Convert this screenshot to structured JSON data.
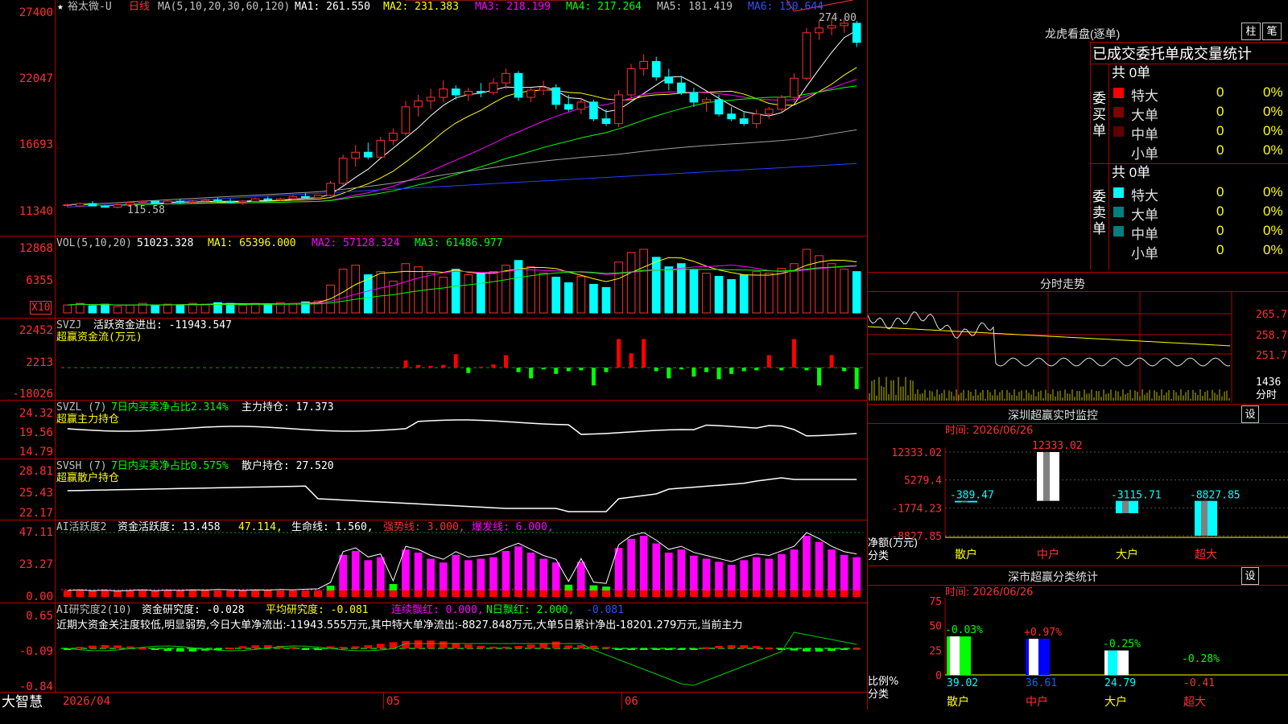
{
  "title_bar": {
    "star": "★",
    "stock_name": "裕太微-U",
    "period": "日线",
    "ma_label": "MA(5,10,20,30,60,120)",
    "ma1": "MA1: 261.550",
    "ma2": "MA2: 231.383",
    "ma3": "MA3: 218.199",
    "ma4": "MA4: 217.264",
    "ma5": "MA5: 181.419",
    "ma6": "MA6: 150.644"
  },
  "price_panel": {
    "y_ticks": [
      "27400",
      "22047",
      "16693",
      "11340"
    ],
    "high_label": "274.00",
    "low_label": "115.58"
  },
  "vol_panel": {
    "label": "VOL(5,10,20)",
    "value": "51023.328",
    "ma1": "MA1: 65396.000",
    "ma2": "MA2: 57128.324",
    "ma3": "MA3: 61486.977",
    "y_ticks": [
      "12868",
      "6355"
    ],
    "unit": "X10"
  },
  "svzj_panel": {
    "label": "SVZJ",
    "text": "活跃资金进出: -11943.547",
    "sub": "超赢资金流(万元)",
    "y_ticks": [
      "22452",
      "2213",
      "-18026"
    ]
  },
  "svzl_panel": {
    "label": "SVZL (7)",
    "text1": "7日内买卖净占比2.314%",
    "text2": "主力持仓: 17.373",
    "sub": "超赢主力持仓",
    "y_ticks": [
      "24.32",
      "19.56",
      "14.79"
    ]
  },
  "svsh_panel": {
    "label": "SVSH (7)",
    "text1": "7日内买卖净占比0.575%",
    "text2": "散户持仓: 27.520",
    "sub": "超赢散户持仓",
    "y_ticks": [
      "28.81",
      "25.43",
      "22.17"
    ]
  },
  "ai_panel": {
    "label": "AI活跃度2",
    "t1": "资金活跃度: 13.458",
    "t2": "47.114,",
    "t3": "生命线: 1.560,",
    "t4": "强势线: 3.000,",
    "t5": "爆发线: 6.000,",
    "y_ticks": [
      "47.11",
      "23.27",
      "0.00"
    ]
  },
  "research_panel": {
    "label": "AI研究度2(10)",
    "t1": "资金研究度: -0.028",
    "t2": "平均研究度: -0.081",
    "t3": "连续飘红: 0.000,",
    "t4": "N日飘红: 2.000,",
    "t5": "-0.081",
    "comment": "近期大资金关注度较低,明显弱势,今日大单净流出:-11943.555万元,其中特大单净流出:-8827.848万元,大单5日累计净出-18201.279万元,当前主力",
    "y_ticks": [
      "0.65",
      "-0.09",
      "-0.84"
    ]
  },
  "date_axis": {
    "brand": "大智慧",
    "d1": "2026/04",
    "d2": "05",
    "d3": "06"
  },
  "right_top": {
    "title": "龙虎看盘(逐单)",
    "btn1": "柱",
    "btn2": "笔",
    "stats_title": "已成交委托单成交量统计",
    "buy_label": "委买单",
    "sell_label": "委卖单",
    "buy_total": "共 0单",
    "sell_total": "共 0单",
    "buy_rows": [
      {
        "name": "特大",
        "count": "0",
        "pct": "0%",
        "color": "#ff0000"
      },
      {
        "name": "大单",
        "count": "0",
        "pct": "0%",
        "color": "#800000"
      },
      {
        "name": "中单",
        "count": "0",
        "pct": "0%",
        "color": "#600000"
      },
      {
        "name": "小单",
        "count": "0",
        "pct": "0%",
        "color": ""
      }
    ],
    "sell_rows": [
      {
        "name": "特大",
        "count": "0",
        "pct": "0%",
        "color": "#00ffff"
      },
      {
        "name": "大单",
        "count": "0",
        "pct": "0%",
        "color": "#008080"
      },
      {
        "name": "中单",
        "count": "0",
        "pct": "0%",
        "color": "#008080"
      },
      {
        "name": "小单",
        "count": "0",
        "pct": "0%",
        "color": ""
      }
    ]
  },
  "intraday": {
    "title": "分时走势",
    "y_ticks": [
      "265.7",
      "258.7",
      "251.7"
    ],
    "vol_label": "1436",
    "vol_unit": "分时"
  },
  "sz_monitor": {
    "title": "深圳超赢实时监控",
    "set": "设",
    "time": "时间: 2026/06/26",
    "y_ticks": [
      "12333.02",
      "5279.4",
      "-1774.23",
      "-8827.85"
    ],
    "y_label": "净额(万元)",
    "x_label": "分类",
    "categories": [
      "散户",
      "中户",
      "大户",
      "超大"
    ],
    "values": [
      "-389.47",
      "12333.02",
      "-3115.71",
      "-8827.85"
    ]
  },
  "sz_stats": {
    "title": "深市超赢分类统计",
    "set": "设",
    "time": "时间: 2026/06/26",
    "y_ticks": [
      "75",
      "50",
      "25",
      "0"
    ],
    "y_label": "比例%",
    "x_label": "分类",
    "categories": [
      "散户",
      "中户",
      "大户",
      "超大"
    ],
    "pcts": [
      "-0.03%",
      "+0.97%",
      "-0.25%",
      "-0.28%"
    ],
    "values": [
      "39.02",
      "36.61",
      "24.79",
      "-0.41"
    ]
  },
  "chart_data": {
    "type": "candlestick",
    "period": "daily",
    "y_range": [
      11340,
      27400
    ],
    "high": 274.0,
    "low": 115.58,
    "candles": [
      [
        118,
        119,
        116,
        118
      ],
      [
        117,
        120,
        116,
        119
      ],
      [
        119,
        121,
        117,
        117
      ],
      [
        117,
        118,
        115.58,
        116
      ],
      [
        116,
        119,
        115,
        118
      ],
      [
        118,
        121,
        117,
        120
      ],
      [
        120,
        122,
        118,
        121
      ],
      [
        121,
        121,
        119,
        119
      ],
      [
        119,
        122,
        118,
        121
      ],
      [
        121,
        123,
        119,
        120
      ],
      [
        120,
        122,
        119,
        121
      ],
      [
        121,
        123,
        120,
        122
      ],
      [
        122,
        124,
        120,
        121
      ],
      [
        121,
        123,
        119,
        120
      ],
      [
        120,
        122,
        118,
        121
      ],
      [
        121,
        124,
        120,
        123
      ],
      [
        123,
        125,
        121,
        122
      ],
      [
        122,
        124,
        121,
        123
      ],
      [
        123,
        126,
        122,
        125
      ],
      [
        125,
        128,
        124,
        124
      ],
      [
        124,
        126,
        122,
        126
      ],
      [
        126,
        138,
        125,
        136
      ],
      [
        136,
        160,
        134,
        157
      ],
      [
        157,
        168,
        150,
        162
      ],
      [
        162,
        170,
        156,
        158
      ],
      [
        158,
        175,
        157,
        172
      ],
      [
        172,
        182,
        168,
        178
      ],
      [
        178,
        205,
        176,
        200
      ],
      [
        200,
        210,
        192,
        205
      ],
      [
        205,
        215,
        198,
        208
      ],
      [
        208,
        222,
        204,
        215
      ],
      [
        215,
        218,
        206,
        210
      ],
      [
        210,
        216,
        205,
        213
      ],
      [
        213,
        220,
        208,
        212
      ],
      [
        212,
        224,
        210,
        220
      ],
      [
        220,
        232,
        215,
        228
      ],
      [
        228,
        230,
        205,
        208
      ],
      [
        208,
        216,
        204,
        214
      ],
      [
        214,
        222,
        210,
        216
      ],
      [
        216,
        219,
        198,
        202
      ],
      [
        202,
        210,
        196,
        198
      ],
      [
        198,
        208,
        194,
        204
      ],
      [
        204,
        206,
        188,
        190
      ],
      [
        190,
        198,
        184,
        186
      ],
      [
        186,
        214,
        183,
        210
      ],
      [
        210,
        236,
        205,
        232
      ],
      [
        232,
        244,
        226,
        238
      ],
      [
        238,
        242,
        222,
        225
      ],
      [
        225,
        232,
        214,
        220
      ],
      [
        220,
        226,
        210,
        212
      ],
      [
        212,
        216,
        200,
        204
      ],
      [
        204,
        208,
        196,
        206
      ],
      [
        206,
        210,
        192,
        194
      ],
      [
        194,
        200,
        188,
        190
      ],
      [
        190,
        196,
        184,
        186
      ],
      [
        186,
        198,
        182,
        194
      ],
      [
        194,
        200,
        190,
        198
      ],
      [
        198,
        210,
        196,
        208
      ],
      [
        208,
        228,
        204,
        224
      ],
      [
        224,
        266,
        222,
        262
      ],
      [
        262,
        272,
        256,
        266
      ],
      [
        266,
        274,
        260,
        268
      ],
      [
        268,
        274,
        262,
        270
      ],
      [
        270,
        272,
        250,
        254
      ]
    ],
    "volume": [
      10,
      12,
      9,
      11,
      8,
      10,
      12,
      9,
      11,
      10,
      12,
      11,
      13,
      12,
      10,
      12,
      11,
      13,
      12,
      14,
      15,
      35,
      55,
      60,
      48,
      52,
      40,
      62,
      58,
      50,
      45,
      55,
      48,
      50,
      52,
      60,
      66,
      58,
      50,
      45,
      38,
      46,
      36,
      32,
      64,
      76,
      80,
      70,
      58,
      62,
      54,
      50,
      46,
      42,
      48,
      52,
      50,
      56,
      62,
      80,
      72,
      62,
      55,
      52
    ],
    "zj": [
      0,
      0,
      0,
      0,
      0,
      0,
      0,
      0,
      0,
      0,
      0,
      0,
      0,
      0,
      0,
      0,
      0,
      0,
      0,
      0,
      0,
      0,
      0,
      0,
      0,
      0,
      0,
      4000,
      1500,
      1000,
      1500,
      7500,
      -3000,
      500,
      1800,
      7000,
      -2500,
      -6000,
      -1000,
      -3500,
      -2000,
      -1500,
      -10000,
      -2500,
      16000,
      8000,
      16000,
      -2000,
      -6000,
      -1000,
      -5000,
      -2500,
      -6500,
      -3500,
      -2000,
      -1500,
      7000,
      -1500,
      16000,
      -1500,
      -10000,
      7000,
      -2000,
      -12000
    ]
  }
}
